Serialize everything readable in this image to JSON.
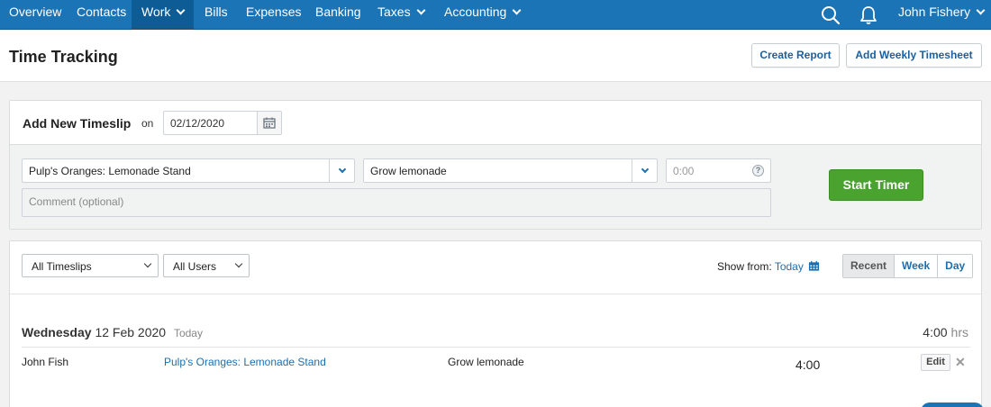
{
  "nav": {
    "items": [
      {
        "label": "Overview"
      },
      {
        "label": "Contacts"
      },
      {
        "label": "Work"
      },
      {
        "label": "Bills"
      },
      {
        "label": "Expenses"
      },
      {
        "label": "Banking"
      },
      {
        "label": "Taxes"
      },
      {
        "label": "Accounting"
      }
    ],
    "user_name": "John Fishery",
    "search_icon": "search-icon",
    "bell_icon": "bell-icon"
  },
  "header": {
    "title": "Time Tracking",
    "create_report_label": "Create Report",
    "add_weekly_label": "Add Weekly Timesheet"
  },
  "timeslip": {
    "title": "Add New Timeslip",
    "on_label": "on",
    "date_value": "02/12/2020",
    "project_value": "Pulp's Oranges: Lemonade Stand",
    "task_value": "Grow lemonade",
    "hours_placeholder": "0:00",
    "comment_placeholder": "Comment (optional)",
    "start_timer_label": "Start Timer"
  },
  "filters": {
    "timeslips_value": "All Timeslips",
    "users_value": "All Users",
    "show_from_label": "Show from:",
    "show_from_value": "Today",
    "views": [
      "Recent",
      "Week",
      "Day"
    ]
  },
  "day_group": {
    "weekday": "Wednesday",
    "date": "12 Feb 2020",
    "today_tag": "Today",
    "total": "4:00",
    "total_unit": "hrs",
    "rows": [
      {
        "user": "John Fish",
        "project": "Pulp's Oranges: Lemonade Stand",
        "task": "Grow lemonade",
        "hours": "4:00",
        "edit_label": "Edit"
      }
    ]
  },
  "colors": {
    "nav_bg": "#1a74b5",
    "accent": "#1a6fb0",
    "start_button": "#4aa22f"
  }
}
